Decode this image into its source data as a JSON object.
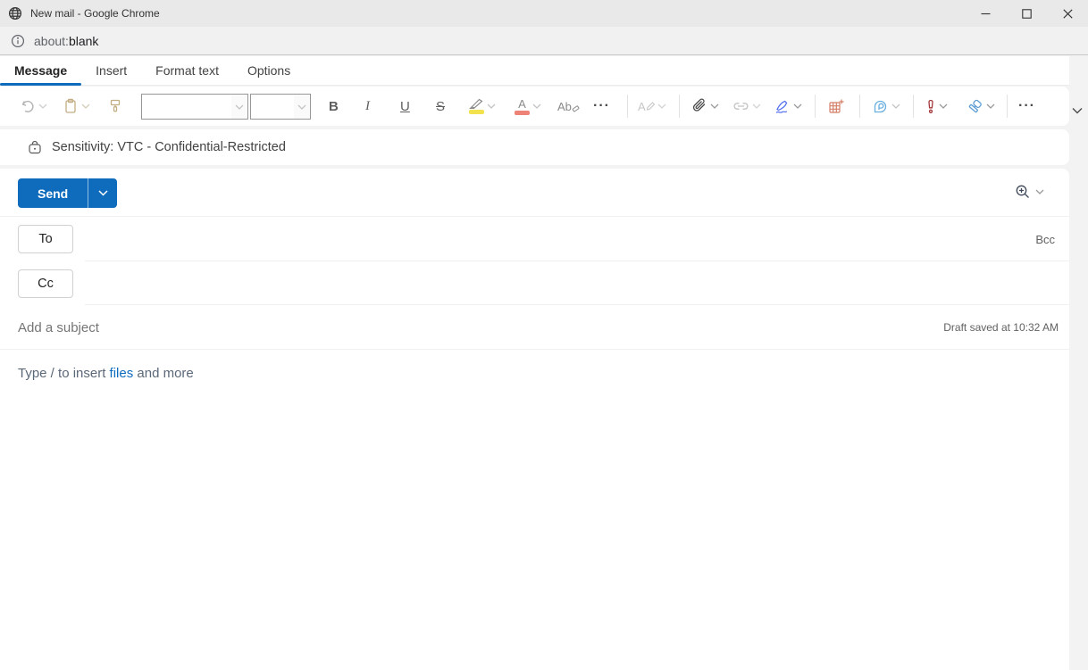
{
  "window": {
    "title": "New mail - Google Chrome"
  },
  "urlbar": {
    "scheme": "about:",
    "path": "blank"
  },
  "ribbon": {
    "active_tab": "Message",
    "tabs": [
      {
        "label": "Message"
      },
      {
        "label": "Insert"
      },
      {
        "label": "Format text"
      },
      {
        "label": "Options"
      }
    ]
  },
  "toolbar": {
    "font_name_value": "",
    "font_size_value": "",
    "glyphs": {
      "bold": "B",
      "italic": "I",
      "underline": "U",
      "strikethrough": "S",
      "font_color": "A",
      "clear_format": "Ab",
      "draw_text": "A",
      "more": "···",
      "importance": "!"
    },
    "icons": [
      "undo",
      "paste",
      "format-painter",
      "font-name-select",
      "font-size-select",
      "bold",
      "italic",
      "underline",
      "strikethrough",
      "text-highlight-color",
      "font-color",
      "clear-formatting",
      "more-formatting-options",
      "draw-text",
      "attach-file",
      "insert-link",
      "insert-signature",
      "insert-table",
      "loop-component",
      "high-importance",
      "sensitivity",
      "more-options",
      "collapse-ribbon"
    ]
  },
  "sensitivity_bar": {
    "label": "Sensitivity: VTC - Confidential-Restricted"
  },
  "compose": {
    "send_label": "Send",
    "to_label": "To",
    "cc_label": "Cc",
    "bcc_label": "Bcc",
    "subject_placeholder": "Add a subject",
    "draft_status": "Draft saved at 10:32 AM",
    "body_prefix": "Type / to insert ",
    "body_link": "files",
    "body_suffix": " and more"
  },
  "colors": {
    "accent_blue": "#0f6cbd",
    "highlight_yellow": "#f2e34e",
    "font_color_red": "#ee8277",
    "importance_red": "#a4373a",
    "signature_blue": "#4f6bed",
    "table_salmon": "#d47e66",
    "loop_blue": "#69aede",
    "sensitivity_blue": "#5d9bd3",
    "link_blue": "#0f6cbd"
  }
}
